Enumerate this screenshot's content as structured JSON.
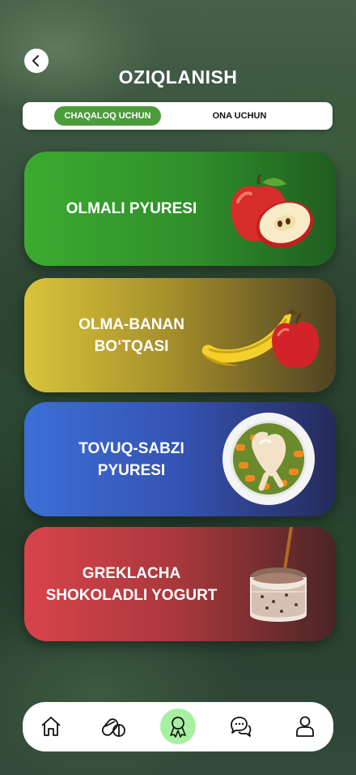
{
  "header": {
    "title": "OZIQLANISH",
    "back_icon": "chevron-left-icon"
  },
  "tabs": [
    {
      "label": "CHAQALOQ UCHUN",
      "active": true
    },
    {
      "label": "ONA UCHUN",
      "active": false
    }
  ],
  "cards": [
    {
      "label": "OLMALI PYURESI",
      "image": "apple-icon",
      "color": "#3cab30"
    },
    {
      "label": "OLMA-BANAN\nBO‘TQASI",
      "image": "banana-apple-icon",
      "color": "#d9c43b"
    },
    {
      "label": "TOVUQ-SABZI\nPYURESI",
      "image": "chicken-carrot-plate-icon",
      "color": "#3c6fd6"
    },
    {
      "label": "GREKLACHA\nSHOKOLADLI YOGURT",
      "image": "chocolate-yogurt-jar-icon",
      "color": "#d8434a"
    }
  ],
  "bottom_nav": [
    {
      "icon": "home-icon",
      "active": false
    },
    {
      "icon": "pills-icon",
      "active": false
    },
    {
      "icon": "award-icon",
      "active": true,
      "active_color": "#a7f0a0"
    },
    {
      "icon": "chat-icon",
      "active": false
    },
    {
      "icon": "profile-icon",
      "active": false
    }
  ]
}
